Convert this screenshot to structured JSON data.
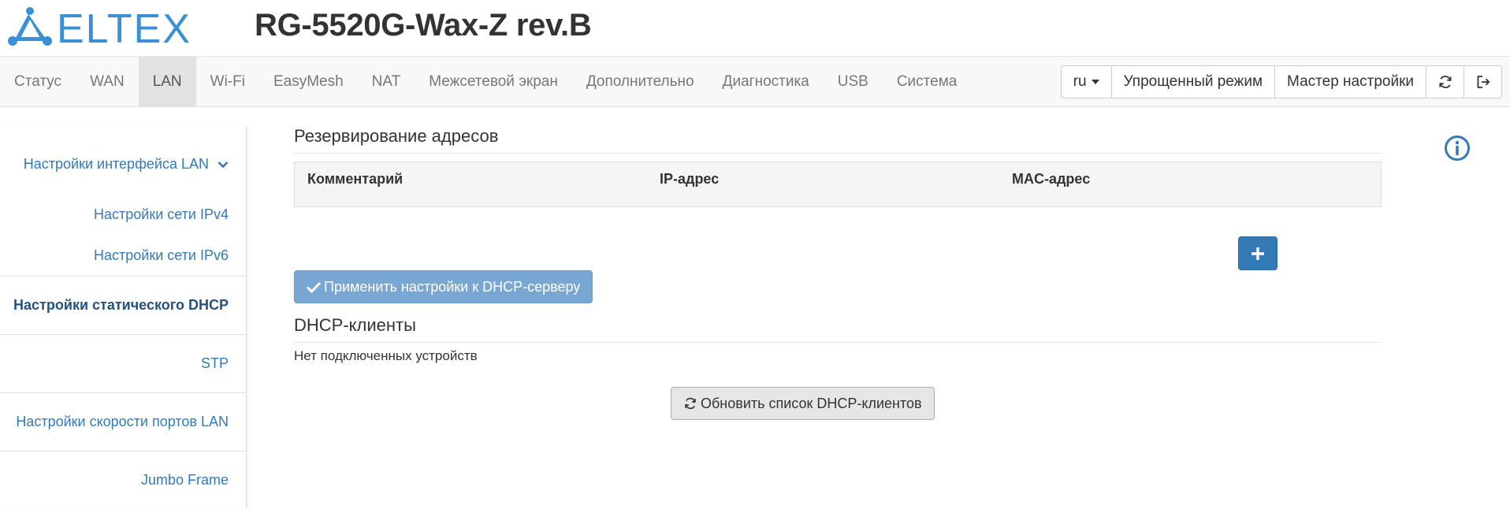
{
  "header": {
    "brand": "ELTEX",
    "device_title": "RG-5520G-Wax-Z rev.B",
    "brand_color": "#3a8fd6"
  },
  "nav": {
    "tabs": [
      {
        "label": "Статус"
      },
      {
        "label": "WAN"
      },
      {
        "label": "LAN",
        "active": true
      },
      {
        "label": "Wi-Fi"
      },
      {
        "label": "EasyMesh"
      },
      {
        "label": "NAT"
      },
      {
        "label": "Межсетевой экран"
      },
      {
        "label": "Дополнительно"
      },
      {
        "label": "Диагностика"
      },
      {
        "label": "USB"
      },
      {
        "label": "Система"
      }
    ],
    "language": "ru",
    "simple_mode": "Упрощенный режим",
    "wizard": "Мастер настройки",
    "refresh_icon": "refresh-icon",
    "logout_icon": "logout-icon"
  },
  "sidebar": {
    "lan_interface": "Настройки интерфейса LAN",
    "ipv4": "Настройки сети IPv4",
    "ipv6": "Настройки сети IPv6",
    "static_dhcp": "Настройки статического DHCP",
    "stp": "STP",
    "port_speed": "Настройки скорости портов LAN",
    "jumbo": "Jumbo Frame"
  },
  "main": {
    "reservation_title": "Резервирование адресов",
    "columns": [
      "Комментарий",
      "IP-адрес",
      "MAC-адрес"
    ],
    "add_icon": "plus-icon",
    "apply_label": "Применить настройки к DHCP-серверу",
    "clients_title": "DHCP-клиенты",
    "no_devices": "Нет подключенных устройств",
    "refresh_label": "Обновить список DHCP-клиентов",
    "info_icon": "info-icon"
  },
  "colors": {
    "link": "#337ab7",
    "primary": "#337ab7",
    "primary_disabled": "#78a7d3"
  }
}
